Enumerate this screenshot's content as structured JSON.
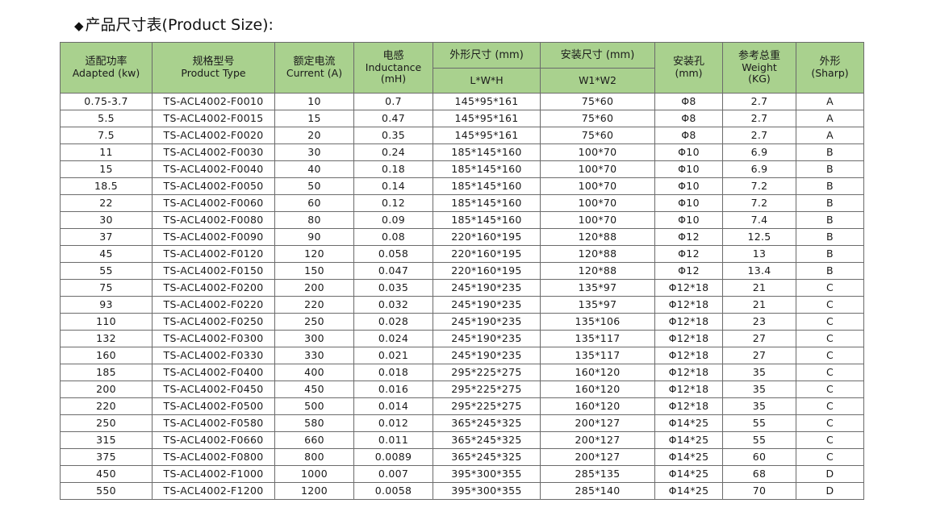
{
  "title": {
    "bullet": "◆",
    "text": "产品尺寸表(Product Size):"
  },
  "table": {
    "headers": {
      "power": {
        "zh": "适配功率",
        "en": "Adapted (kw)"
      },
      "type": {
        "zh": "规格型号",
        "en": "Product Type"
      },
      "current": {
        "zh": "额定电流",
        "en": "Current (A)"
      },
      "inductance": {
        "zh": "电感",
        "en1": "Inductance",
        "en2": "(mH)"
      },
      "outer": {
        "zh": "外形尺寸 (mm)",
        "sub": "L*W*H"
      },
      "install": {
        "zh": "安装尺寸 (mm)",
        "sub": "W1*W2"
      },
      "hole": {
        "zh": "安装孔",
        "en": "(mm)"
      },
      "weight": {
        "zh": "参考总重",
        "en1": "Weight",
        "en2": "(KG)"
      },
      "shape": {
        "zh": "外形",
        "en": "(Sharp)"
      }
    },
    "rows": [
      [
        "0.75-3.7",
        "TS-ACL4002-F0010",
        "10",
        "0.7",
        "145*95*161",
        "75*60",
        "Φ8",
        "2.7",
        "A"
      ],
      [
        "5.5",
        "TS-ACL4002-F0015",
        "15",
        "0.47",
        "145*95*161",
        "75*60",
        "Φ8",
        "2.7",
        "A"
      ],
      [
        "7.5",
        "TS-ACL4002-F0020",
        "20",
        "0.35",
        "145*95*161",
        "75*60",
        "Φ8",
        "2.7",
        "A"
      ],
      [
        "11",
        "TS-ACL4002-F0030",
        "30",
        "0.24",
        "185*145*160",
        "100*70",
        "Φ10",
        "6.9",
        "B"
      ],
      [
        "15",
        "TS-ACL4002-F0040",
        "40",
        "0.18",
        "185*145*160",
        "100*70",
        "Φ10",
        "6.9",
        "B"
      ],
      [
        "18.5",
        "TS-ACL4002-F0050",
        "50",
        "0.14",
        "185*145*160",
        "100*70",
        "Φ10",
        "7.2",
        "B"
      ],
      [
        "22",
        "TS-ACL4002-F0060",
        "60",
        "0.12",
        "185*145*160",
        "100*70",
        "Φ10",
        "7.2",
        "B"
      ],
      [
        "30",
        "TS-ACL4002-F0080",
        "80",
        "0.09",
        "185*145*160",
        "100*70",
        "Φ10",
        "7.4",
        "B"
      ],
      [
        "37",
        "TS-ACL4002-F0090",
        "90",
        "0.08",
        "220*160*195",
        "120*88",
        "Φ12",
        "12.5",
        "B"
      ],
      [
        "45",
        "TS-ACL4002-F0120",
        "120",
        "0.058",
        "220*160*195",
        "120*88",
        "Φ12",
        "13",
        "B"
      ],
      [
        "55",
        "TS-ACL4002-F0150",
        "150",
        "0.047",
        "220*160*195",
        "120*88",
        "Φ12",
        "13.4",
        "B"
      ],
      [
        "75",
        "TS-ACL4002-F0200",
        "200",
        "0.035",
        "245*190*235",
        "135*97",
        "Φ12*18",
        "21",
        "C"
      ],
      [
        "93",
        "TS-ACL4002-F0220",
        "220",
        "0.032",
        "245*190*235",
        "135*97",
        "Φ12*18",
        "21",
        "C"
      ],
      [
        "110",
        "TS-ACL4002-F0250",
        "250",
        "0.028",
        "245*190*235",
        "135*106",
        "Φ12*18",
        "23",
        "C"
      ],
      [
        "132",
        "TS-ACL4002-F0300",
        "300",
        "0.024",
        "245*190*235",
        "135*117",
        "Φ12*18",
        "27",
        "C"
      ],
      [
        "160",
        "TS-ACL4002-F0330",
        "330",
        "0.021",
        "245*190*235",
        "135*117",
        "Φ12*18",
        "27",
        "C"
      ],
      [
        "185",
        "TS-ACL4002-F0400",
        "400",
        "0.018",
        "295*225*275",
        "160*120",
        "Φ12*18",
        "35",
        "C"
      ],
      [
        "200",
        "TS-ACL4002-F0450",
        "450",
        "0.016",
        "295*225*275",
        "160*120",
        "Φ12*18",
        "35",
        "C"
      ],
      [
        "220",
        "TS-ACL4002-F0500",
        "500",
        "0.014",
        "295*225*275",
        "160*120",
        "Φ12*18",
        "35",
        "C"
      ],
      [
        "250",
        "TS-ACL4002-F0580",
        "580",
        "0.012",
        "365*245*325",
        "200*127",
        "Φ14*25",
        "55",
        "C"
      ],
      [
        "315",
        "TS-ACL4002-F0660",
        "660",
        "0.011",
        "365*245*325",
        "200*127",
        "Φ14*25",
        "55",
        "C"
      ],
      [
        "375",
        "TS-ACL4002-F0800",
        "800",
        "0.0089",
        "365*245*325",
        "200*127",
        "Φ14*25",
        "60",
        "C"
      ],
      [
        "450",
        "TS-ACL4002-F1000",
        "1000",
        "0.007",
        "395*300*355",
        "285*135",
        "Φ14*25",
        "68",
        "D"
      ],
      [
        "550",
        "TS-ACL4002-F1200",
        "1200",
        "0.0058",
        "395*300*355",
        "285*140",
        "Φ14*25",
        "70",
        "D"
      ]
    ]
  },
  "colors": {
    "header_bg": "#a9d18e",
    "border": "#6b6b6b"
  }
}
